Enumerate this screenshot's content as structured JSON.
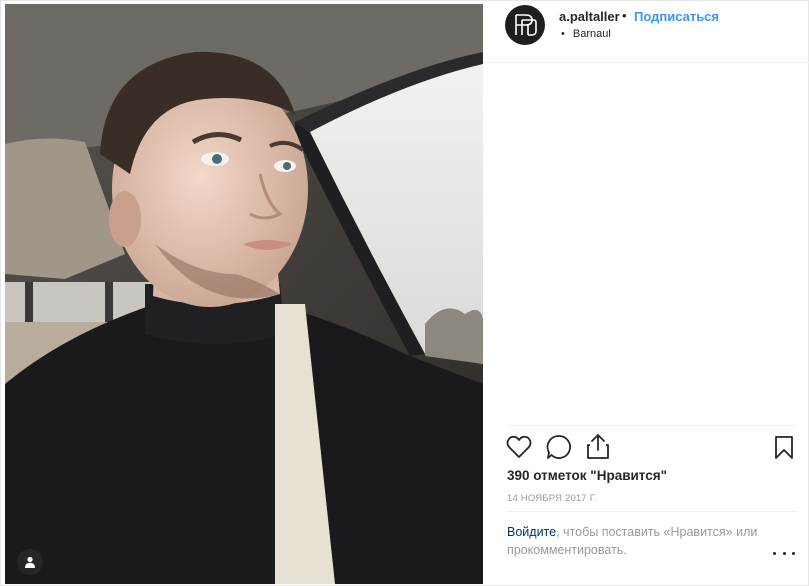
{
  "post": {
    "username": "a.paltaller",
    "separator": "•",
    "follow_label": "Подписаться",
    "location_dot": "•",
    "location": "Barnaul",
    "likes": "390 отметок \"Нравится\"",
    "date": "14 НОЯБРЯ 2017 Г.",
    "login_link": "Войдите",
    "login_rest": ", чтобы поставить «Нравится» или прокомментировать."
  },
  "icons": {
    "avatar": "monogram-logo-icon",
    "like": "heart-icon",
    "comment": "comment-bubble-icon",
    "share": "share-upload-icon",
    "save": "bookmark-icon",
    "tagged": "person-tag-icon",
    "more": "more-options-icon"
  },
  "colors": {
    "follow_link": "#3897f0",
    "login_link": "#003569",
    "muted_text": "#999999",
    "primary_text": "#262626"
  }
}
